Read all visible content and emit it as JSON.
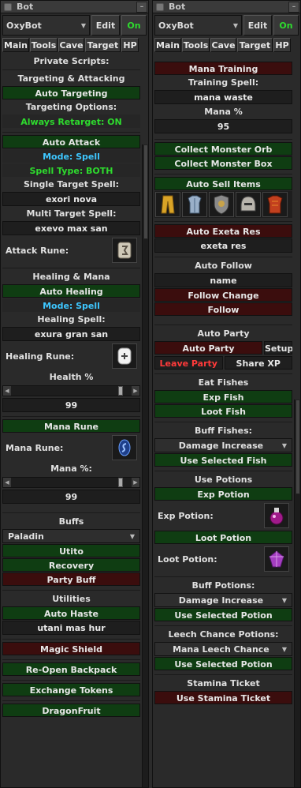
{
  "left": {
    "title": "Bot",
    "profile": "OxyBot",
    "edit_label": "Edit",
    "on_label": "On",
    "tabs": [
      "Main",
      "Tools",
      "Cave",
      "Target",
      "HP"
    ],
    "private_scripts": "Private Scripts:",
    "targeting_title": "Targeting & Attacking",
    "auto_targeting": "Auto Targeting",
    "targeting_options": "Targeting Options:",
    "always_retarget": "Always Retarget: ON",
    "auto_attack": "Auto Attack",
    "mode_spell": "Mode: Spell",
    "spell_type": "Spell Type: BOTH",
    "single_target_label": "Single Target Spell:",
    "single_target_value": "exori nova",
    "multi_target_label": "Multi Target Spell:",
    "multi_target_value": "exevo max san",
    "attack_rune_label": "Attack Rune:",
    "healing_title": "Healing & Mana",
    "auto_healing": "Auto Healing",
    "healing_mode": "Mode: Spell",
    "healing_spell_label": "Healing Spell:",
    "healing_spell_value": "exura gran san",
    "healing_rune_label": "Healing Rune:",
    "health_pct_label": "Health %",
    "health_pct_value": "99",
    "mana_rune_title": "Mana Rune",
    "mana_rune_label": "Mana Rune:",
    "mana_pct_label": "Mana %:",
    "mana_pct_value": "99",
    "buffs_title": "Buffs",
    "vocation": "Paladin",
    "utito": "Utito",
    "recovery": "Recovery",
    "party_buff": "Party Buff",
    "utilities_title": "Utilities",
    "auto_haste": "Auto Haste",
    "haste_spell": "utani mas hur",
    "magic_shield": "Magic Shield",
    "reopen_backpack": "Re-Open Backpack",
    "exchange_tokens": "Exchange Tokens",
    "dragonfruit": "DragonFruit"
  },
  "right": {
    "title": "Bot",
    "profile": "OxyBot",
    "edit_label": "Edit",
    "on_label": "On",
    "tabs": [
      "Main",
      "Tools",
      "Cave",
      "Target",
      "HP"
    ],
    "mana_training": "Mana Training",
    "training_spell_label": "Training Spell:",
    "training_spell_value": "mana waste",
    "mana_pct_label": "Mana %",
    "mana_pct_value": "95",
    "collect_orb": "Collect Monster Orb",
    "collect_box": "Collect Monster Box",
    "auto_sell_items": "Auto Sell Items",
    "auto_exeta_res": "Auto Exeta Res",
    "exeta_value": "exeta res",
    "auto_follow_title": "Auto Follow",
    "follow_name": "name",
    "follow_change": "Follow Change",
    "follow": "Follow",
    "auto_party_title": "Auto Party",
    "auto_party": "Auto Party",
    "setup": "Setup",
    "leave_party": "Leave Party",
    "share_xp": "Share XP",
    "eat_fishes": "Eat Fishes",
    "exp_fish": "Exp Fish",
    "loot_fish": "Loot Fish",
    "buff_fishes": "Buff Fishes:",
    "buff_fish_select": "Damage Increase",
    "use_selected_fish": "Use Selected Fish",
    "use_potions": "Use Potions",
    "exp_potion": "Exp Potion",
    "exp_potion_label": "Exp Potion:",
    "loot_potion": "Loot Potion",
    "loot_potion_label": "Loot Potion:",
    "buff_potions": "Buff Potions:",
    "buff_potion_select": "Damage Increase",
    "use_selected_potion": "Use Selected Potion",
    "leech_title": "Leech Chance Potions:",
    "leech_select": "Mana Leech Chance",
    "use_selected_potion_2": "Use Selected Potion",
    "stamina_ticket": "Stamina Ticket",
    "use_stamina_ticket": "Use Stamina Ticket"
  },
  "colors": {
    "green_bar": "#0f3d12",
    "red_bar": "#3b0d0d",
    "on": "#2edb2e",
    "cyan": "#3ec7ff",
    "leave_party": "#ff3a3a"
  }
}
